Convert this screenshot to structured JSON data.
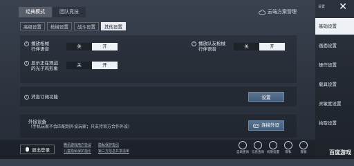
{
  "top_tabs": [
    "经典模式",
    "团队竞技"
  ],
  "cloud_label": "云端方案管理",
  "sub_tabs": [
    "高级设置",
    "枪械设置",
    "战斗设置",
    "其他设置"
  ],
  "settings": {
    "fire_voice": {
      "label_line1": "播放枪械",
      "label_line2": "行伴语音",
      "off": "关",
      "on": "开"
    },
    "teammate_voice": {
      "label_line1": "播放队友枪械",
      "label_line2": "行伴语音",
      "off": "关",
      "on": "开"
    },
    "show_nightvision": {
      "label_line1": "显示正在观战",
      "label_line2": "的光子鸡形象",
      "off": "关",
      "on": "开"
    }
  },
  "subscription": {
    "label": "消息订阅功能",
    "button": "设置"
  },
  "peripheral": {
    "label": "外接设备",
    "note": "（手机玩家不会匹配到外设玩家；只支持官方合作外设）",
    "button": "连接外设"
  },
  "bottom": {
    "logout": "退出登录",
    "links_row1": [
      "腾讯游戏用户协议",
      "隐私保护指引"
    ],
    "links_row2": [
      "儿童隐私保护指引",
      "第三方信息共享清单"
    ],
    "icons": [
      {
        "name": "self-check-icon",
        "label": "自助查询"
      },
      {
        "name": "info-query-icon",
        "label": "信息查询"
      },
      {
        "name": "rights-icon",
        "label": "权限设置"
      },
      {
        "name": "privacy-icon",
        "label": "隐私"
      },
      {
        "name": "cs-icon",
        "label": "客服"
      }
    ]
  },
  "sidebar": {
    "top_label": "设置",
    "items": [
      "基础设置",
      "画面设置",
      "操作设置",
      "载具设置",
      "灵敏度设置",
      "拾取设置"
    ]
  },
  "watermark": "百度游戏"
}
